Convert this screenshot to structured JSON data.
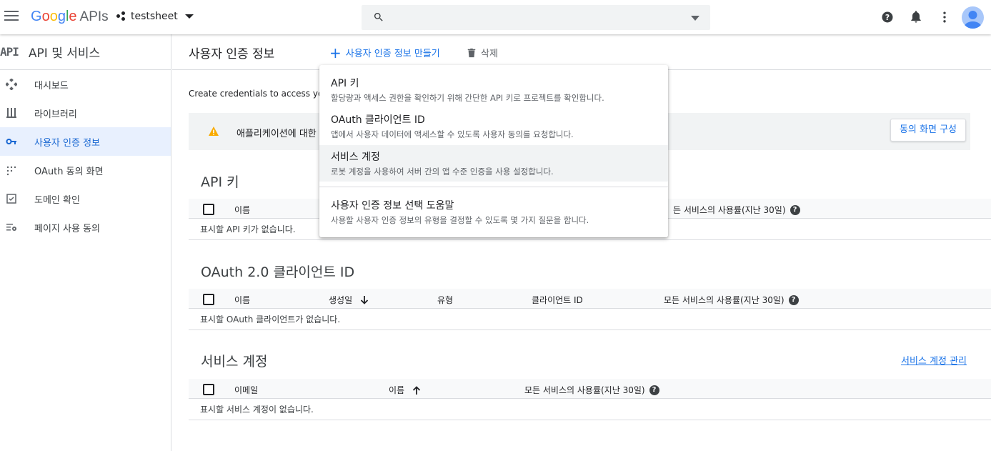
{
  "topbar": {
    "logo_text": "Google",
    "logo_apis": "APIs",
    "project_name": "testsheet",
    "search_placeholder": ""
  },
  "sidebar": {
    "badge": "API",
    "title": "API 및 서비스",
    "items": [
      {
        "label": "대시보드",
        "icon": "dashboard-icon"
      },
      {
        "label": "라이브러리",
        "icon": "library-icon"
      },
      {
        "label": "사용자 인증 정보",
        "icon": "key-icon",
        "active": true
      },
      {
        "label": "OAuth 동의 화면",
        "icon": "consent-icon"
      },
      {
        "label": "도메인 확인",
        "icon": "domain-check-icon"
      },
      {
        "label": "페이지 사용 동의",
        "icon": "page-consent-icon"
      }
    ]
  },
  "main": {
    "title": "사용자 인증 정보",
    "create_label": "사용자 인증 정보 만들기",
    "delete_label": "삭제",
    "description": "Create credentials to access you",
    "banner_text": "애플리케이션에 대한",
    "consent_button": "동의 화면 구성",
    "api_keys": {
      "title": "API 키",
      "col_name": "이름",
      "col_usage": "든 서비스의 사용률(지난 30일)",
      "empty": "표시할 API 키가 없습니다."
    },
    "oauth": {
      "title": "OAuth 2.0 클라이언트 ID",
      "col_name": "이름",
      "col_created": "생성일",
      "col_type": "유형",
      "col_client": "클라이언트 ID",
      "col_usage": "모든 서비스의 사용률(지난 30일)",
      "empty": "표시할 OAuth 클라이언트가 없습니다."
    },
    "service": {
      "title": "서비스 계정",
      "manage_link": "서비스 계정 관리",
      "col_email": "이메일",
      "col_name": "이름",
      "col_usage": "모든 서비스의 사용률(지난 30일)",
      "empty": "표시할 서비스 계정이 없습니다."
    }
  },
  "dropdown": {
    "items": [
      {
        "title": "API 키",
        "desc": "할당량과 액세스 권한을 확인하기 위해 간단한 API 키로 프로젝트를 확인합니다."
      },
      {
        "title": "OAuth 클라이언트 ID",
        "desc": "앱에서 사용자 데이터에 액세스할 수 있도록 사용자 동의를 요청합니다."
      },
      {
        "title": "서비스 계정",
        "desc": "로봇 계정을 사용하여 서버 간의 앱 수준 인증을 사용 설정합니다."
      },
      {
        "title": "사용자 인증 정보 선택 도움말",
        "desc": "사용할 사용자 인증 정보의 유형을 결정할 수 있도록 몇 가지 질문을 합니다."
      }
    ]
  },
  "colors": {
    "accent": "#1a73e8",
    "active_bg": "#e8f0fe",
    "warning": "#f9ab00"
  }
}
